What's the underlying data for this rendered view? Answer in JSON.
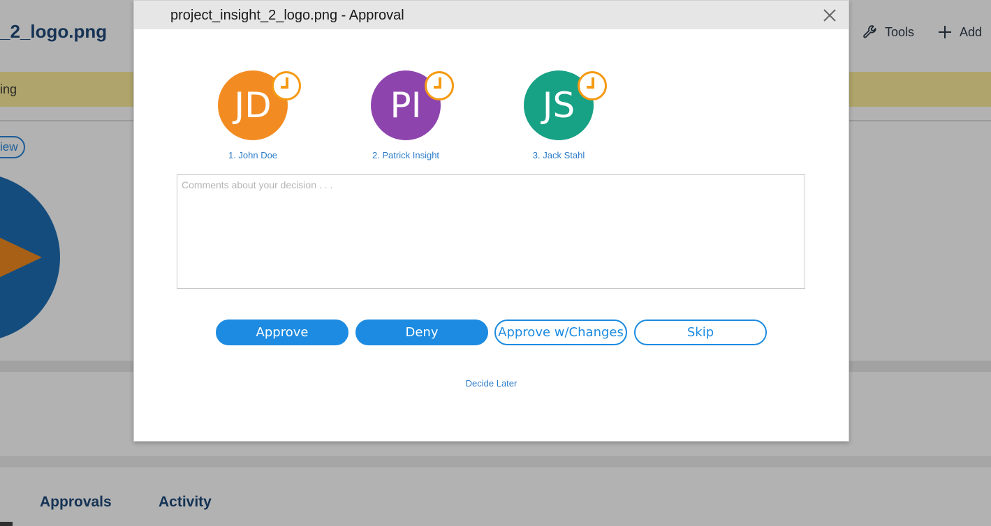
{
  "background": {
    "title": "_2_logo.png",
    "tools_label": "Tools",
    "add_label": "Add",
    "banner_text": "ing",
    "view_button_label": "iew",
    "tabs": [
      "Approvals",
      "Activity"
    ],
    "colors": {
      "banner": "#fbeb9a",
      "logo_circle": "#1d6fb3",
      "logo_arrow": "#ef8a1f"
    }
  },
  "modal": {
    "title": "project_insight_2_logo.png - Approval",
    "approvers": [
      {
        "initials": "JD",
        "name": "1. John Doe",
        "color": "#f28c22"
      },
      {
        "initials": "PI",
        "name": "2. Patrick Insight",
        "color": "#8e44ad"
      },
      {
        "initials": "JS",
        "name": "3. Jack Stahl",
        "color": "#17a185"
      }
    ],
    "status_icon": "clock-icon",
    "status_color": "#f59a12",
    "comments_placeholder": "Comments about your decision . . .",
    "buttons": {
      "approve": "Approve",
      "deny": "Deny",
      "approve_changes": "Approve w/Changes",
      "skip": "Skip"
    },
    "decide_later": "Decide Later",
    "accent_color": "#1c8be1"
  }
}
